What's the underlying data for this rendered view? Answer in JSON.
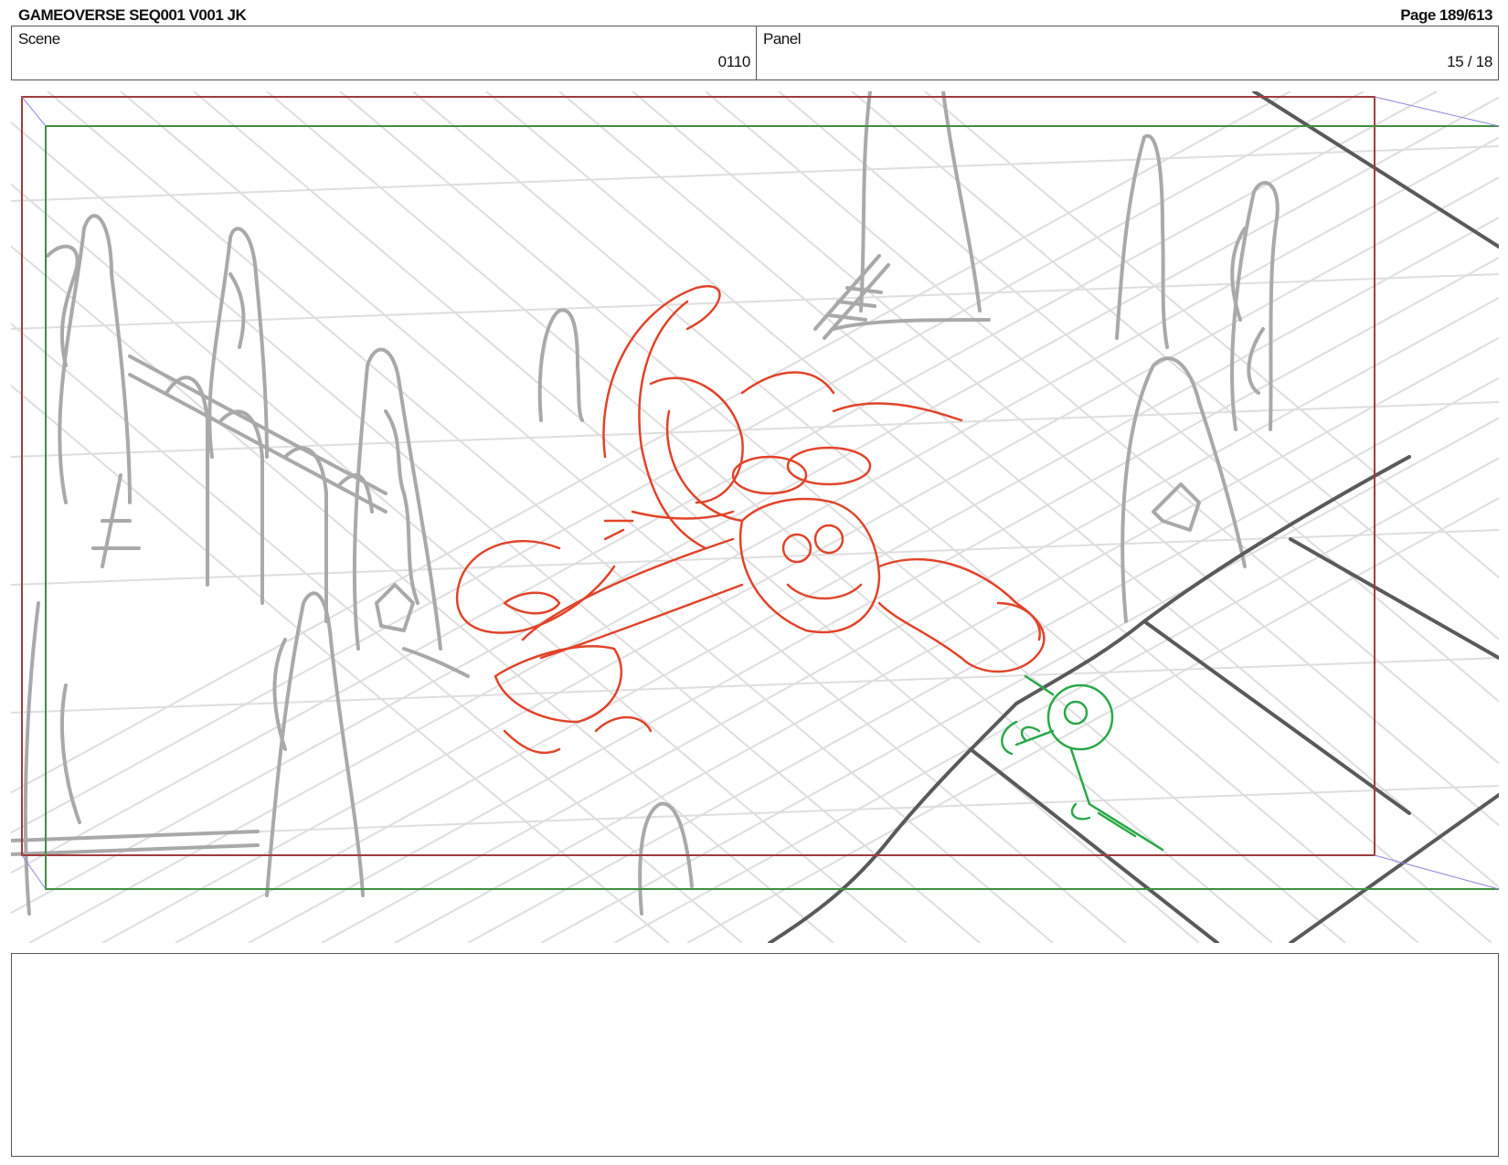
{
  "header": {
    "title": "GAMEOVERSE SEQ001 V001 JK",
    "page": "Page 189/613"
  },
  "scene": {
    "label": "Scene",
    "value": "0110"
  },
  "panel": {
    "label": "Panel",
    "value": "15 / 18"
  },
  "colors": {
    "action_safe": "#a23b3b",
    "title_safe": "#3f8f3f",
    "rough_red": "#e0442a",
    "rough_green": "#2aa84a",
    "background_sketch": "#a9a9a9",
    "grid": "#dcdcdc"
  },
  "notes": {
    "text": ""
  }
}
